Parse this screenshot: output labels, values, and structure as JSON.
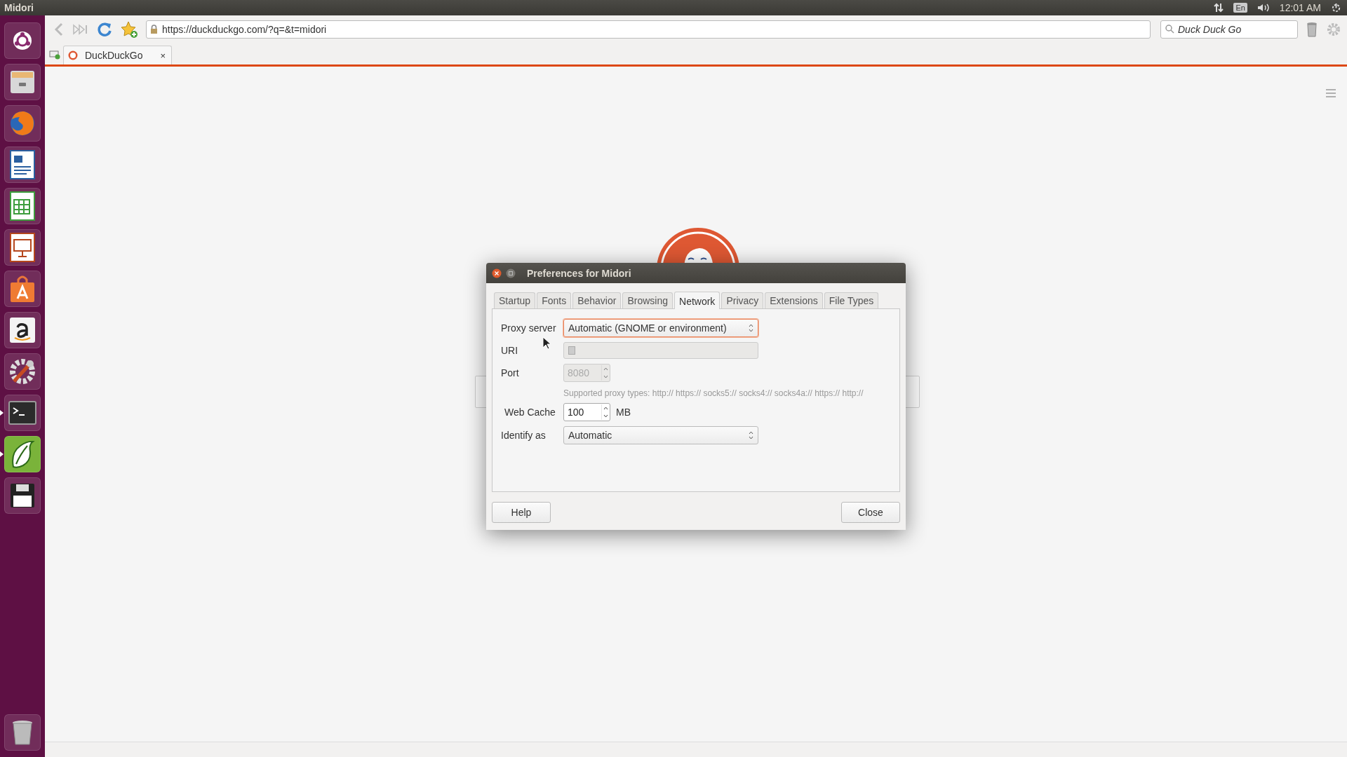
{
  "top_panel": {
    "app_name": "Midori",
    "keyboard_layout": "En",
    "clock": "12:01 AM"
  },
  "launcher": [
    {
      "running": false,
      "active": false
    },
    {
      "running": false,
      "active": false
    },
    {
      "running": false,
      "active": false
    },
    {
      "running": false,
      "active": false
    },
    {
      "running": false,
      "active": false
    },
    {
      "running": false,
      "active": false
    },
    {
      "running": false,
      "active": false
    },
    {
      "running": false,
      "active": false
    },
    {
      "running": false,
      "active": false
    },
    {
      "running": true,
      "active": false
    },
    {
      "running": true,
      "active": true
    },
    {
      "running": false,
      "active": false
    }
  ],
  "browser": {
    "url": "https://duckduckgo.com/?q=&t=midori",
    "search_placeholder": "Duck Duck Go",
    "tabs": [
      {
        "label": "DuckDuckGo",
        "close": "×",
        "selected": true
      }
    ]
  },
  "dialog": {
    "title": "Preferences for Midori",
    "tabs": [
      {
        "label": "Startup",
        "selected": false
      },
      {
        "label": "Fonts",
        "selected": false
      },
      {
        "label": "Behavior",
        "selected": false
      },
      {
        "label": "Browsing",
        "selected": false
      },
      {
        "label": "Network",
        "selected": true
      },
      {
        "label": "Privacy",
        "selected": false
      },
      {
        "label": "Extensions",
        "selected": false
      },
      {
        "label": "File Types",
        "selected": false
      }
    ],
    "proxy_server": {
      "label": "Proxy server",
      "value": "Automatic (GNOME or environment)",
      "focused": true
    },
    "uri": {
      "label": "URI",
      "disabled": true
    },
    "port": {
      "label": "Port",
      "value": "8080",
      "disabled": true
    },
    "proxy_hint": "Supported proxy types: http:// https:// socks5:// socks4:// socks4a:// https:// http://",
    "web_cache": {
      "label": "Web Cache",
      "value": "100",
      "unit": "MB"
    },
    "identify_as": {
      "label": "Identify as",
      "value": "Automatic",
      "focused": false
    },
    "buttons": {
      "help": "Help",
      "close": "Close"
    }
  }
}
